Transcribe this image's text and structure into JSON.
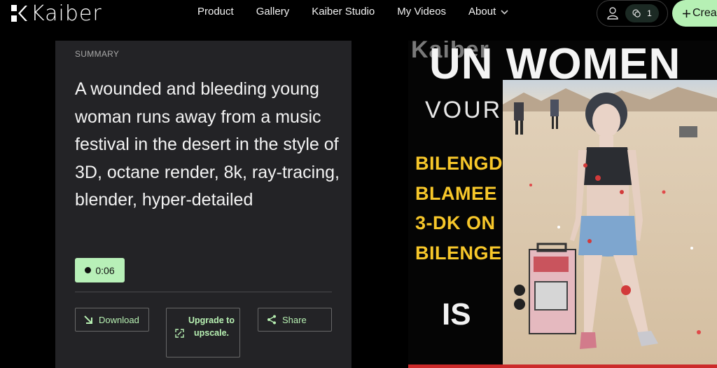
{
  "brand": {
    "name": "Kaiber"
  },
  "nav": {
    "links": [
      {
        "label": "Product"
      },
      {
        "label": "Gallery"
      },
      {
        "label": "Kaiber Studio"
      },
      {
        "label": "My Videos"
      },
      {
        "label": "About"
      }
    ],
    "credits": "1",
    "create_label": "Crea"
  },
  "summary": {
    "heading": "SUMMARY",
    "text": "A wounded and bleeding young woman runs away from a music festival in the desert in the style of 3D, octane render, 8k, ray-tracing, blender, hyper-detailed",
    "duration": "0:06"
  },
  "actions": {
    "download_label": "Download",
    "upgrade_label": "Upgrade to upscale.",
    "share_label": "Share"
  },
  "video_frame": {
    "watermark": "Kaiber",
    "headline": "UN WOMEN",
    "subline": "VOUR",
    "yellow_lines": [
      "BILENGD",
      "BLAMEE",
      "3-DK ON",
      "BILENGE"
    ],
    "footer_word": "IS"
  },
  "colors": {
    "accent_green": "#b8f0b8",
    "panel_bg": "#232326",
    "yellow_text": "#f7c72a"
  },
  "icons": [
    "kaiber-logo-icon",
    "chevron-down-icon",
    "person-icon",
    "coins-icon",
    "plus-icon",
    "download-arrow-icon",
    "expand-icon",
    "share-icon"
  ]
}
